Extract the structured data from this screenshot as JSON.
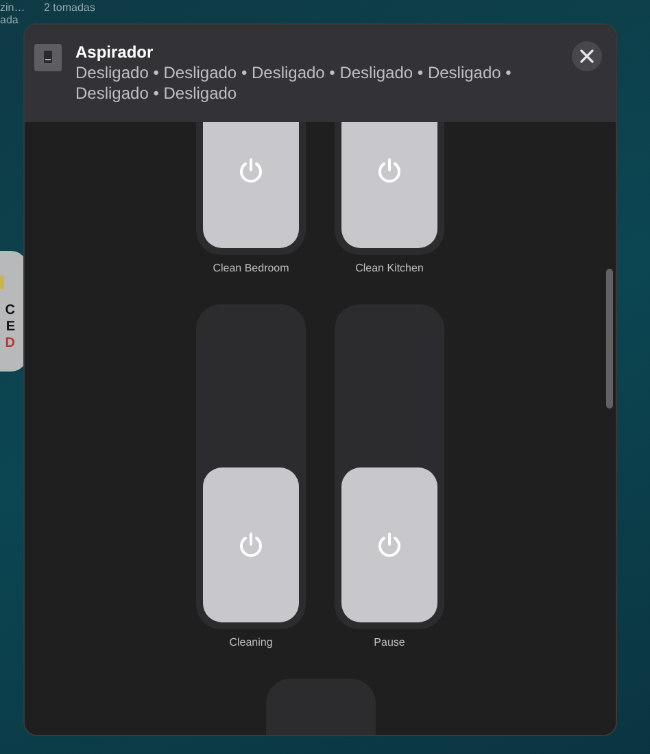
{
  "desktop": {
    "labels": [
      {
        "text": "zin…"
      },
      {
        "text": "ada"
      },
      {
        "text": "2 tomadas"
      }
    ],
    "card_letters": [
      "C",
      "E",
      "D"
    ]
  },
  "dialog": {
    "title": "Aspirador",
    "subtitle": "Desligado • Desligado • Desligado • Desligado • Desligado • Desligado • Desligado",
    "tiles": [
      {
        "kind": "tile",
        "label": "Clean Bedroom",
        "level": 0.5
      },
      {
        "kind": "tile",
        "label": "Clean Kitchen",
        "level": 0.5
      },
      {
        "kind": "tile",
        "label": "Cleaning",
        "level": 0.5
      },
      {
        "kind": "tile",
        "label": "Pause",
        "level": 0.5
      },
      {
        "kind": "partial"
      }
    ]
  }
}
